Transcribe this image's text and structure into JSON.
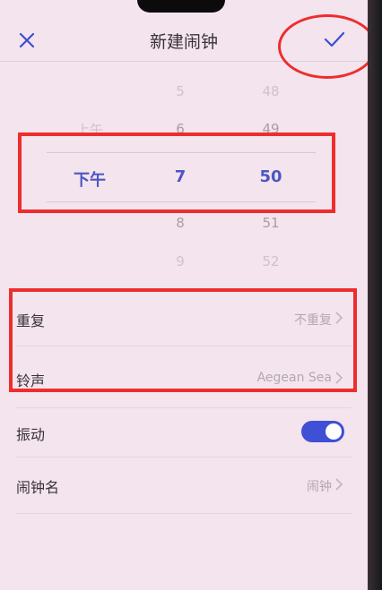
{
  "header": {
    "title": "新建闹钟"
  },
  "picker": {
    "period": {
      "above": "上午",
      "selected": "下午"
    },
    "hour": {
      "above2": "5",
      "above1": "6",
      "selected": "7",
      "below1": "8",
      "below2": "9"
    },
    "minute": {
      "above2": "48",
      "above1": "49",
      "selected": "50",
      "below1": "51",
      "below2": "52"
    }
  },
  "settings": {
    "repeat": {
      "label": "重复",
      "value": "不重复"
    },
    "ringtone": {
      "label": "铃声",
      "value": "Aegean Sea"
    },
    "vibrate": {
      "label": "振动",
      "enabled": true
    },
    "name": {
      "label": "闹钟名",
      "value": "闹钟"
    }
  },
  "colors": {
    "accent": "#4d56c4",
    "toggle_on": "#3f4fd6",
    "annotation": "#ee2d2d"
  }
}
